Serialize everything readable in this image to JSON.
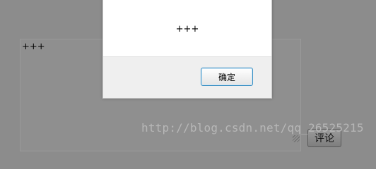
{
  "editor": {
    "content": "+++"
  },
  "comment_button": {
    "label": "评论"
  },
  "watermark": {
    "text": "http://blog.csdn.net/qq_26525215"
  },
  "dialog": {
    "message": "+++",
    "ok_label": "确定"
  }
}
